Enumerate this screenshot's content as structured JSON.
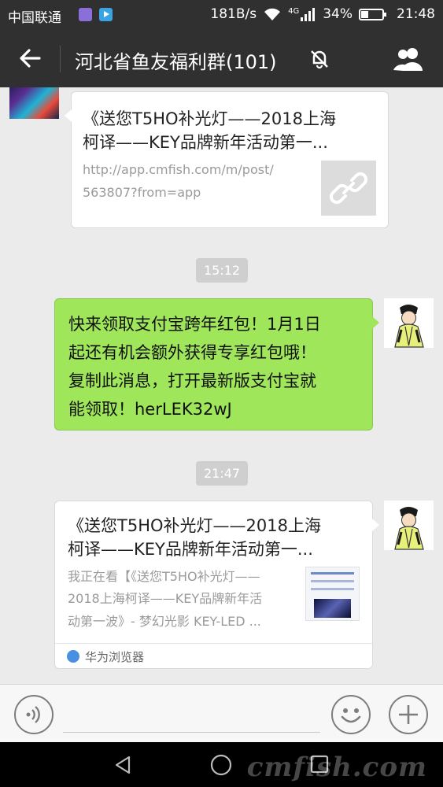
{
  "status_bar": {
    "carrier": "中国联通",
    "speed": "181B/s",
    "network": "4G",
    "battery": "34%",
    "time": "21:48"
  },
  "header": {
    "title": "河北省鱼友福利群(101)"
  },
  "messages": {
    "first_card": {
      "title_line1": "《送您T5HO补光灯——2018上海",
      "title_line2": "柯译——KEY品牌新年活动第一...",
      "url_line1": "http://app.cmfish.com/m/post/",
      "url_line2": "563807?from=app"
    },
    "time_1": "15:12",
    "green_bubble": {
      "line1": "快来领取支付宝跨年红包！1月1日",
      "line2": "起还有机会额外获得专享红包哦！",
      "line3": "复制此消息，打开最新版支付宝就",
      "line4": "能领取！herLEK32wJ"
    },
    "time_2": "21:47",
    "second_card": {
      "title_line1": "《送您T5HO补光灯——2018上海",
      "title_line2": "柯译——KEY品牌新年活动第一...",
      "desc_line1": "我正在看【《送您T5HO补光灯——",
      "desc_line2": "2018上海柯译——KEY品牌新年活",
      "desc_line3": "动第一波》- 梦幻光影 KEY-LED ...",
      "source": "华为浏览器"
    }
  },
  "watermark": "cmfish.com",
  "colors": {
    "header_bg": "#303030",
    "bubble_green": "#9fe65a",
    "chat_bg": "#ebebeb",
    "time_chip": "#cfcfcf"
  }
}
